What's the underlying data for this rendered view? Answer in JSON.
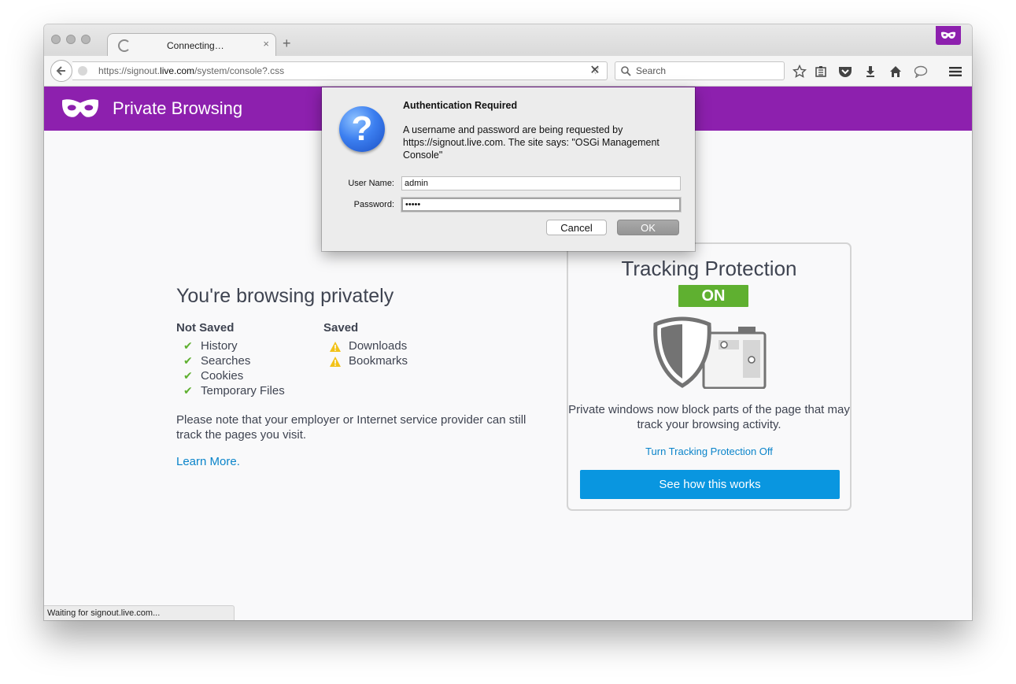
{
  "browser": {
    "tab_title": "Connecting…",
    "tab_close": "×",
    "new_tab": "+",
    "url_prefix": "https://signout.",
    "url_domain": "live.com",
    "url_path": "/system/console?.css",
    "url_dropdown": "▽",
    "stop": "✕",
    "search_placeholder": "Search",
    "status": "Waiting for signout.live.com..."
  },
  "private": {
    "header_title": "Private Browsing",
    "main_title": "You're browsing privately",
    "not_saved_heading": "Not Saved",
    "not_saved_items": [
      "History",
      "Searches",
      "Cookies",
      "Temporary Files"
    ],
    "saved_heading": "Saved",
    "saved_items": [
      "Downloads",
      "Bookmarks"
    ],
    "note": "Please note that your employer or Internet service provider can still track the pages you visit.",
    "learn_more": "Learn More."
  },
  "tracking": {
    "title": "Tracking Protection",
    "status": "ON",
    "description": "Private windows now block parts of the page that may track your browsing activity.",
    "turn_off": "Turn Tracking Protection Off",
    "button": "See how this works"
  },
  "dialog": {
    "title": "Authentication Required",
    "message": "A username and password are being requested by https://signout.live.com. The site says: \"OSGi Management Console\"",
    "username_label": "User Name:",
    "username_value": "admin",
    "password_label": "Password:",
    "password_value": "•••••",
    "cancel": "Cancel",
    "ok": "OK",
    "icon": "question-icon"
  },
  "colors": {
    "private_purple": "#8d20ae",
    "tracking_green": "#5fb030",
    "link_blue": "#0a84ca",
    "button_blue": "#0996e0"
  }
}
